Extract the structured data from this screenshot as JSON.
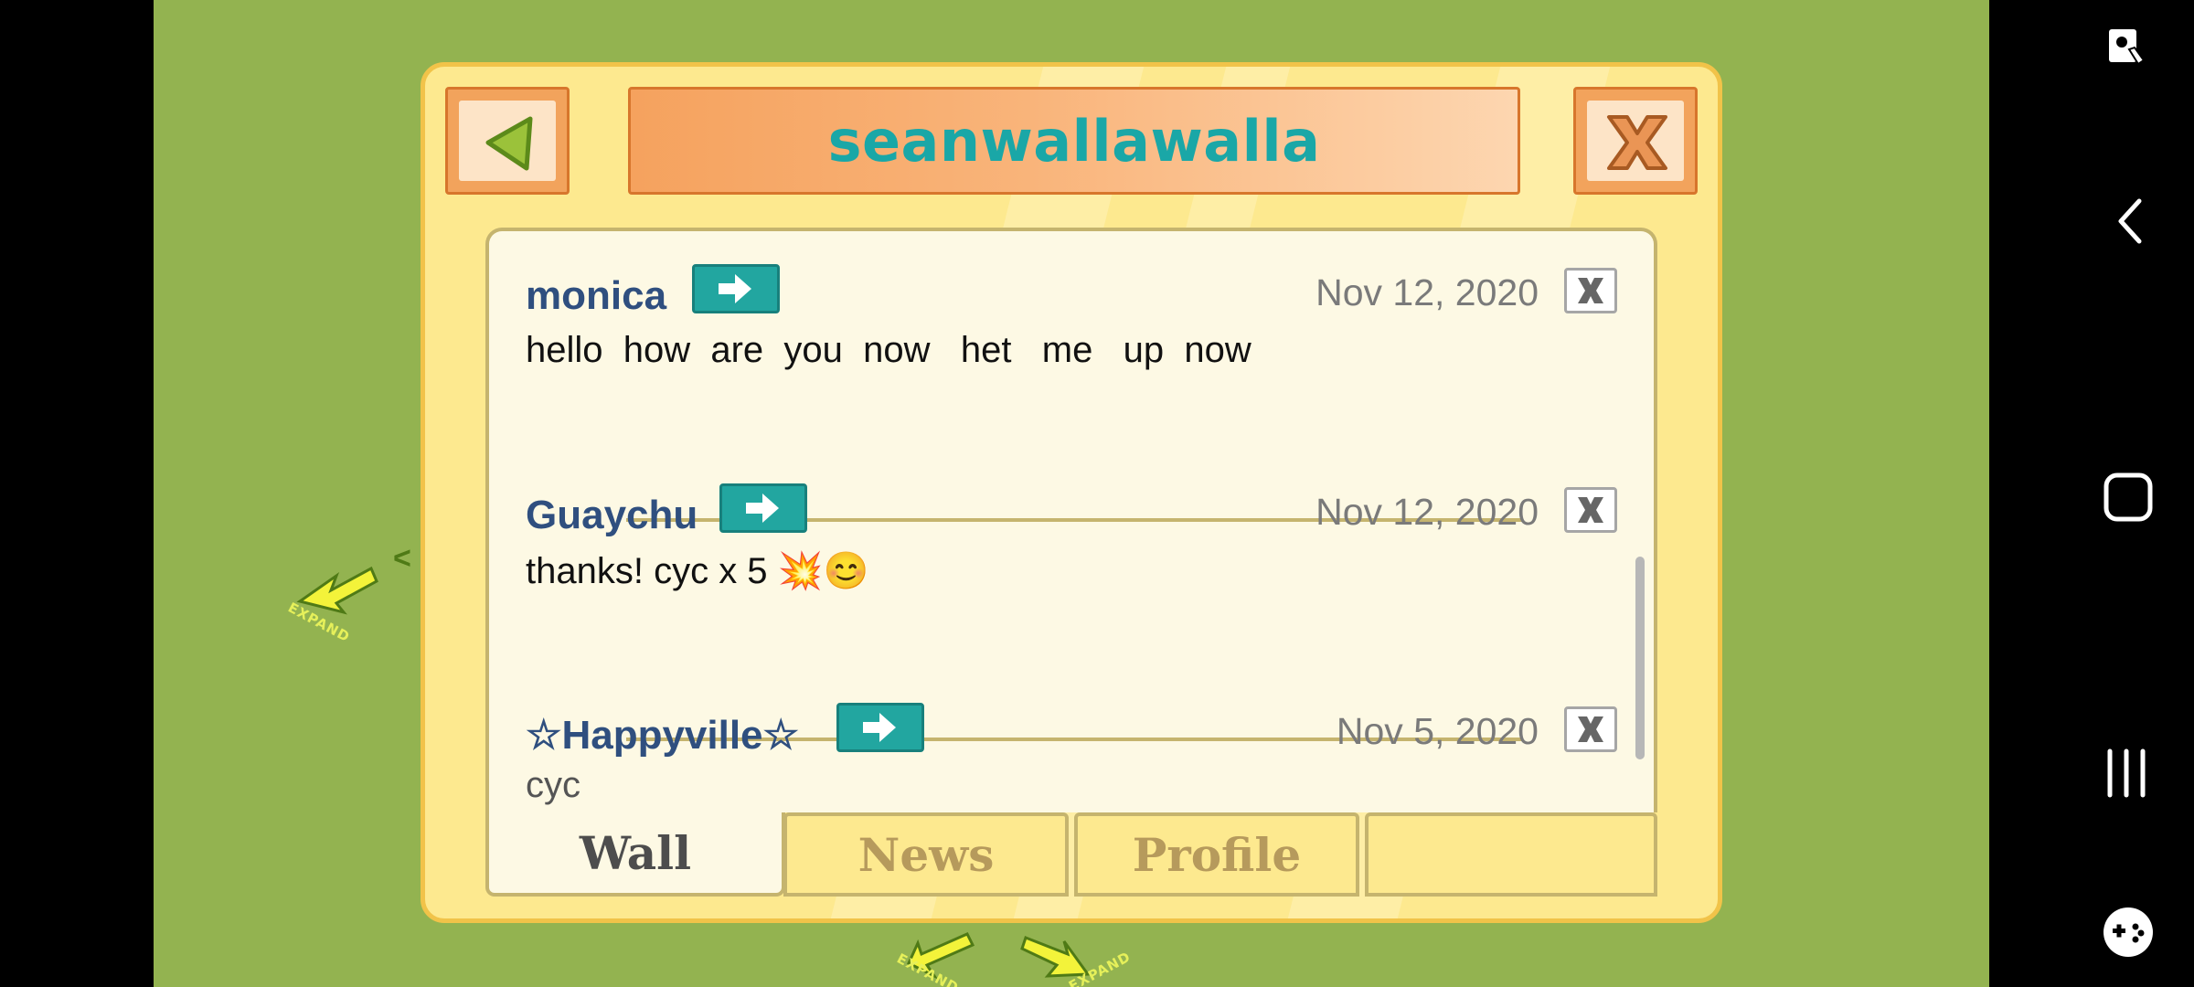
{
  "window": {
    "title": "seanwallawalla"
  },
  "map": {
    "expand_label": "EXPAND"
  },
  "posts": [
    {
      "name": "monica",
      "date": "Nov 12, 2020",
      "message": "hello  how  are  you  now   het   me   up  now"
    },
    {
      "name": "Guaychu",
      "date": "Nov 12, 2020",
      "message": "thanks! cyc x 5 💥😊"
    },
    {
      "name": "☆Happyville☆",
      "date": "Nov 5, 2020",
      "message": "cyc"
    }
  ],
  "tabs": [
    {
      "label": "Wall",
      "active": true
    },
    {
      "label": "News",
      "active": false
    },
    {
      "label": "Profile",
      "active": false
    },
    {
      "label": "",
      "active": false
    }
  ],
  "icons": {
    "back": "green-left-triangle-icon",
    "close": "orange-x-icon",
    "go": "right-arrow-icon",
    "delete": "x-icon"
  },
  "colors": {
    "background": "#93b350",
    "panel": "#fde98f",
    "title_text": "#1aa7a7",
    "name_text": "#2f4f7f",
    "accent_button": "#22a6a0"
  }
}
